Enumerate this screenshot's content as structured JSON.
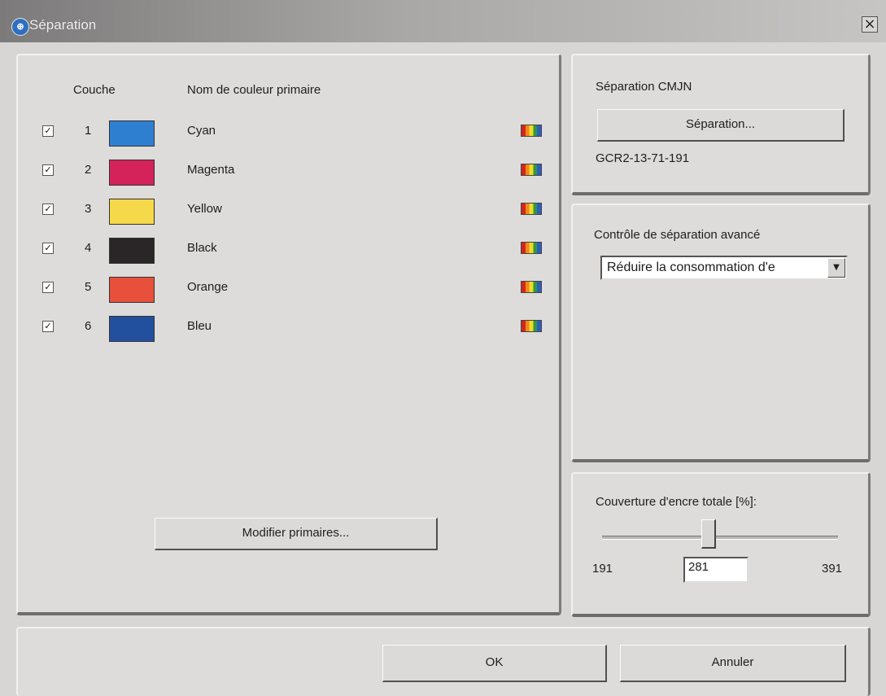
{
  "window": {
    "title": "Séparation",
    "close_glyph": "×",
    "icon": "app-globe-icon"
  },
  "layers": {
    "header_layer": "Couche",
    "header_color_name": "Nom de couleur primaire",
    "rows": [
      {
        "checked": true,
        "number": "1",
        "name": "Cyan",
        "color": "#2f7fd0"
      },
      {
        "checked": true,
        "number": "2",
        "name": "Magenta",
        "color": "#d3235a"
      },
      {
        "checked": true,
        "number": "3",
        "name": "Yellow",
        "color": "#f6d94a"
      },
      {
        "checked": true,
        "number": "4",
        "name": "Black",
        "color": "#2a2628"
      },
      {
        "checked": true,
        "number": "5",
        "name": "Orange",
        "color": "#e8503b"
      },
      {
        "checked": true,
        "number": "6",
        "name": "Bleu",
        "color": "#23509e"
      }
    ],
    "check_glyph": "✓",
    "modify_button": "Modifier primaires..."
  },
  "cmjn": {
    "title": "Séparation CMJN",
    "button": "Séparation...",
    "gcr_value": "GCR2-13-71-191"
  },
  "advanced": {
    "title": "Contrôle de séparation avancé",
    "selected": "Réduire la consommation d'e",
    "arrow_glyph": "▼"
  },
  "ink": {
    "title": "Couverture d'encre totale [%]:",
    "min": "191",
    "max": "391",
    "value": "281",
    "slider_value": 281,
    "slider_min": 191,
    "slider_max": 391
  },
  "footer": {
    "ok": "OK",
    "cancel": "Annuler"
  }
}
